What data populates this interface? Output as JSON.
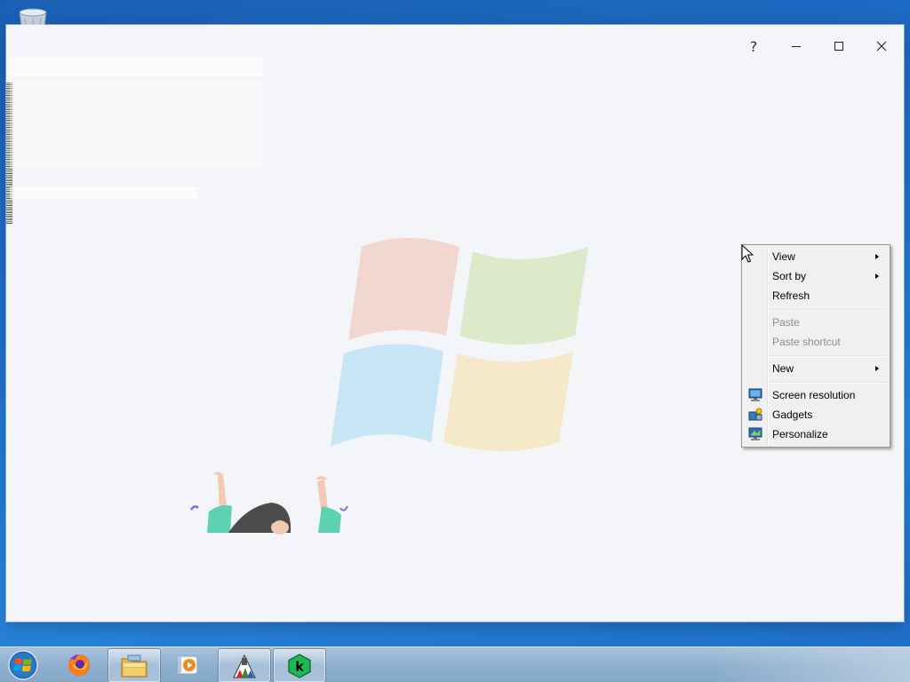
{
  "window": {
    "controls": {
      "help_label": "?"
    }
  },
  "context_menu": {
    "items": [
      {
        "label": "View",
        "submenu": true,
        "enabled": true
      },
      {
        "label": "Sort by",
        "submenu": true,
        "enabled": true
      },
      {
        "label": "Refresh",
        "submenu": false,
        "enabled": true
      },
      {
        "label": "Paste",
        "submenu": false,
        "enabled": false
      },
      {
        "label": "Paste shortcut",
        "submenu": false,
        "enabled": false
      },
      {
        "label": "New",
        "submenu": true,
        "enabled": true
      },
      {
        "label": "Screen resolution",
        "submenu": false,
        "enabled": true,
        "icon": "screen-resolution-icon"
      },
      {
        "label": "Gadgets",
        "submenu": false,
        "enabled": true,
        "icon": "gadgets-icon"
      },
      {
        "label": "Personalize",
        "submenu": false,
        "enabled": true,
        "icon": "personalize-icon"
      }
    ]
  },
  "taskbar": {
    "items": [
      {
        "name": "start-orb",
        "icon": "windows-start-icon"
      },
      {
        "name": "firefox",
        "icon": "firefox-icon",
        "open": false
      },
      {
        "name": "file-explorer",
        "icon": "folder-icon",
        "open": true
      },
      {
        "name": "media-player",
        "icon": "media-player-icon",
        "open": false
      },
      {
        "name": "paint-app",
        "icon": "paint-icon",
        "open": true
      },
      {
        "name": "k-app",
        "icon": "k-app-icon",
        "open": true
      }
    ]
  },
  "colors": {
    "window_bg": "#f3f5f8",
    "menu_bg": "#f0f0f0",
    "disabled_text": "#8d8d8d",
    "taskbar": "#8fb0cf"
  }
}
